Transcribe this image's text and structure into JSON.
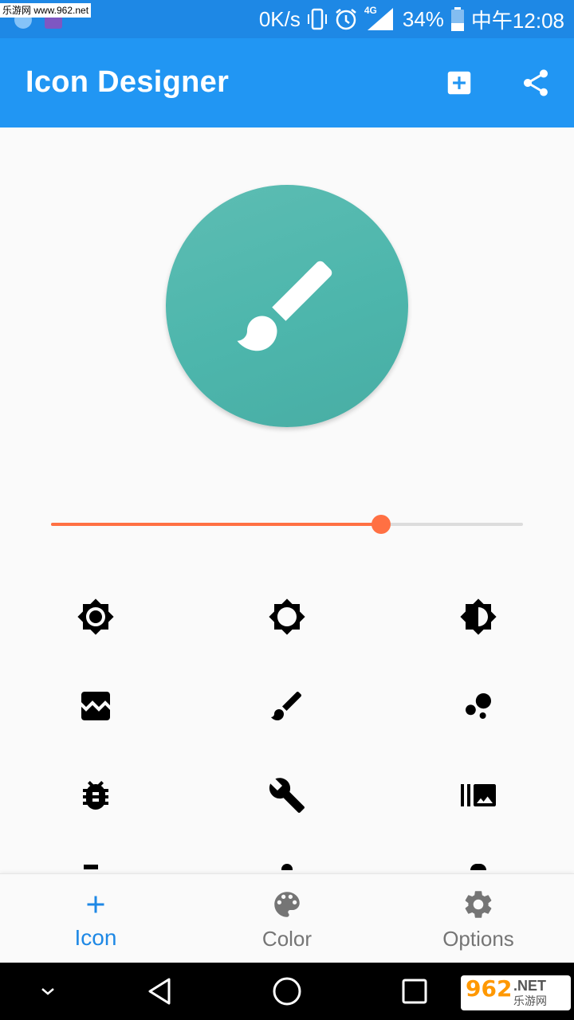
{
  "status_bar": {
    "watermark": "乐游网 www.962.net",
    "speed": "0K/s",
    "network": "4G",
    "battery": "34%",
    "time": "中午12:08"
  },
  "app_bar": {
    "title": "Icon Designer",
    "actions": [
      "add-box-icon",
      "share-icon"
    ]
  },
  "preview": {
    "background_color": "#4db6ac",
    "icon": "brush-icon",
    "icon_color": "#ffffff"
  },
  "size_slider": {
    "value": 0.7,
    "active_color": "#ff7043",
    "track_color": "#dcdcdc"
  },
  "icon_grid": [
    "brightness-high-icon",
    "brightness-low-icon",
    "brightness-medium-icon",
    "broken-image-icon",
    "brush-icon",
    "bubble-chart-icon",
    "bug-report-icon",
    "build-icon",
    "burst-mode-icon"
  ],
  "bottom_nav": {
    "items": [
      {
        "label": "Icon",
        "icon": "add-icon",
        "active": true
      },
      {
        "label": "Color",
        "icon": "palette-icon",
        "active": false
      },
      {
        "label": "Options",
        "icon": "settings-icon",
        "active": false
      }
    ],
    "active_color": "#1e88e5"
  },
  "system_nav": {
    "badge_number": "962",
    "badge_text": ".NET",
    "badge_sub": "乐游网"
  }
}
